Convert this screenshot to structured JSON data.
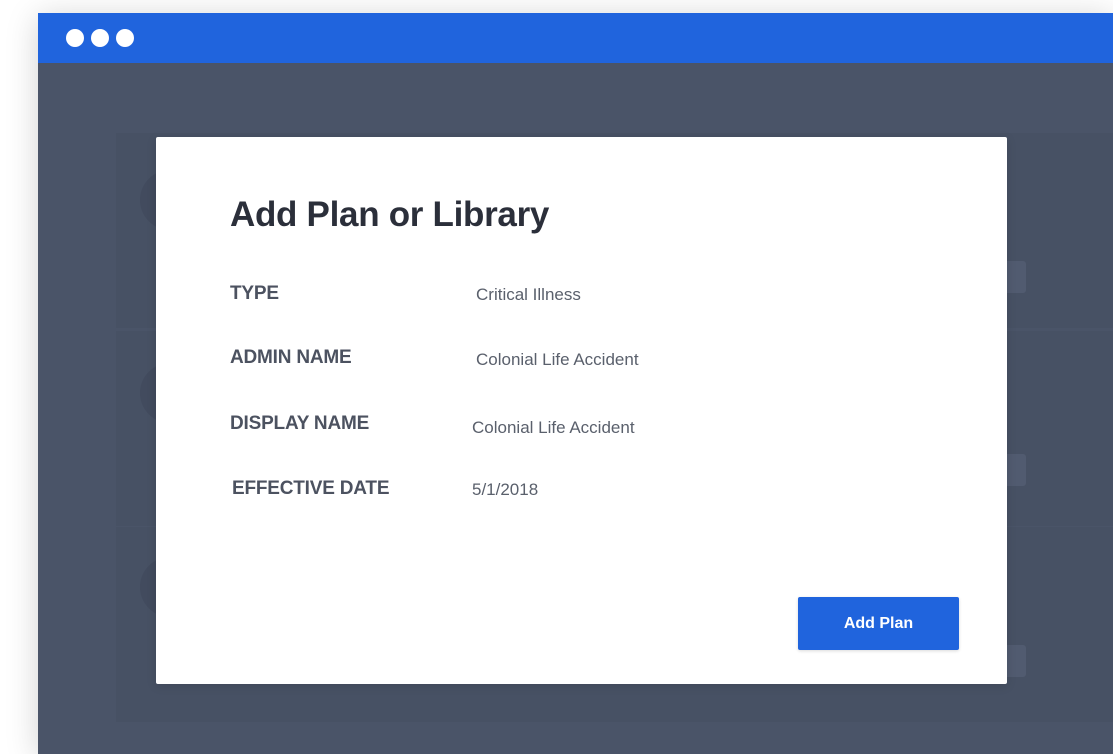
{
  "window": {
    "controls": [
      "dot",
      "dot",
      "dot"
    ],
    "accent_color": "#2064dd",
    "background_color": "#4a5468"
  },
  "modal": {
    "title": "Add Plan or Library",
    "fields": [
      {
        "label": "TYPE",
        "value": "Critical Illness"
      },
      {
        "label": "ADMIN NAME",
        "value": "Colonial Life Accident"
      },
      {
        "label": "DISPLAY NAME",
        "value": "Colonial Life Accident"
      },
      {
        "label": "EFFECTIVE DATE",
        "value": "5/1/2018"
      }
    ],
    "primary_button_label": "Add Plan"
  }
}
